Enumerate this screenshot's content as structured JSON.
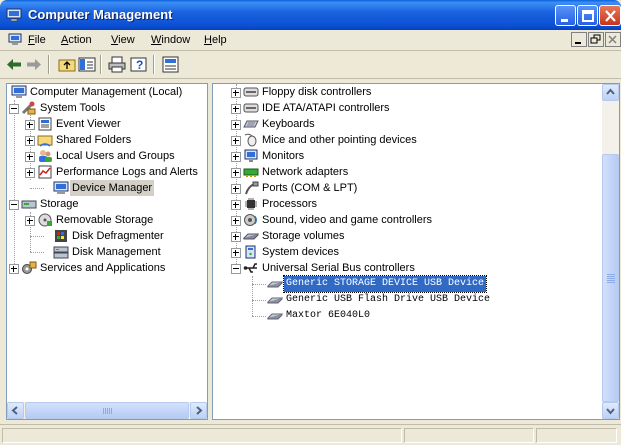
{
  "window": {
    "title": "Computer Management"
  },
  "menu": [
    {
      "key": "file",
      "hotkey": "F",
      "rest": "ile"
    },
    {
      "key": "action",
      "hotkey": "A",
      "rest": "ction"
    },
    {
      "key": "view",
      "hotkey": "V",
      "rest": "iew"
    },
    {
      "key": "window",
      "hotkey": "W",
      "rest": "indow"
    },
    {
      "key": "help",
      "hotkey": "H",
      "rest": "elp"
    }
  ],
  "left_tree": [
    {
      "label": "Computer Management (Local)",
      "icon": "computer-icon"
    },
    {
      "label": "System Tools",
      "icon": "tools-icon"
    },
    {
      "label": "Event Viewer",
      "icon": "event-viewer-icon"
    },
    {
      "label": "Shared Folders",
      "icon": "shared-folders-icon"
    },
    {
      "label": "Local Users and Groups",
      "icon": "users-icon"
    },
    {
      "label": "Performance Logs and Alerts",
      "icon": "performance-icon"
    },
    {
      "label": "Device Manager",
      "icon": "device-manager-icon"
    },
    {
      "label": "Storage",
      "icon": "storage-icon"
    },
    {
      "label": "Removable Storage",
      "icon": "removable-storage-icon"
    },
    {
      "label": "Disk Defragmenter",
      "icon": "defrag-icon"
    },
    {
      "label": "Disk Management",
      "icon": "disk-management-icon"
    },
    {
      "label": "Services and Applications",
      "icon": "services-icon"
    }
  ],
  "right_tree": [
    {
      "label": "Floppy disk controllers",
      "icon": "floppy-controller-icon"
    },
    {
      "label": "IDE ATA/ATAPI controllers",
      "icon": "ide-controller-icon"
    },
    {
      "label": "Keyboards",
      "icon": "keyboard-icon"
    },
    {
      "label": "Mice and other pointing devices",
      "icon": "mouse-icon"
    },
    {
      "label": "Monitors",
      "icon": "monitor-icon"
    },
    {
      "label": "Network adapters",
      "icon": "network-adapter-icon"
    },
    {
      "label": "Ports (COM & LPT)",
      "icon": "port-icon"
    },
    {
      "label": "Processors",
      "icon": "processor-icon"
    },
    {
      "label": "Sound, video and game controllers",
      "icon": "sound-icon"
    },
    {
      "label": "Storage volumes",
      "icon": "storage-volume-icon"
    },
    {
      "label": "System devices",
      "icon": "system-devices-icon"
    },
    {
      "label": "Universal Serial Bus controllers",
      "icon": "usb-icon"
    },
    {
      "label": "Generic STORAGE DEVICE USB Device",
      "icon": "drive-icon"
    },
    {
      "label": "Generic USB Flash Drive USB Device",
      "icon": "drive-icon"
    },
    {
      "label": "Maxtor 6E040L0",
      "icon": "drive-icon"
    }
  ],
  "colors": {
    "title_bar": "#0a4fd2",
    "selection": "#316ac5",
    "window_face": "#ece9d8"
  }
}
